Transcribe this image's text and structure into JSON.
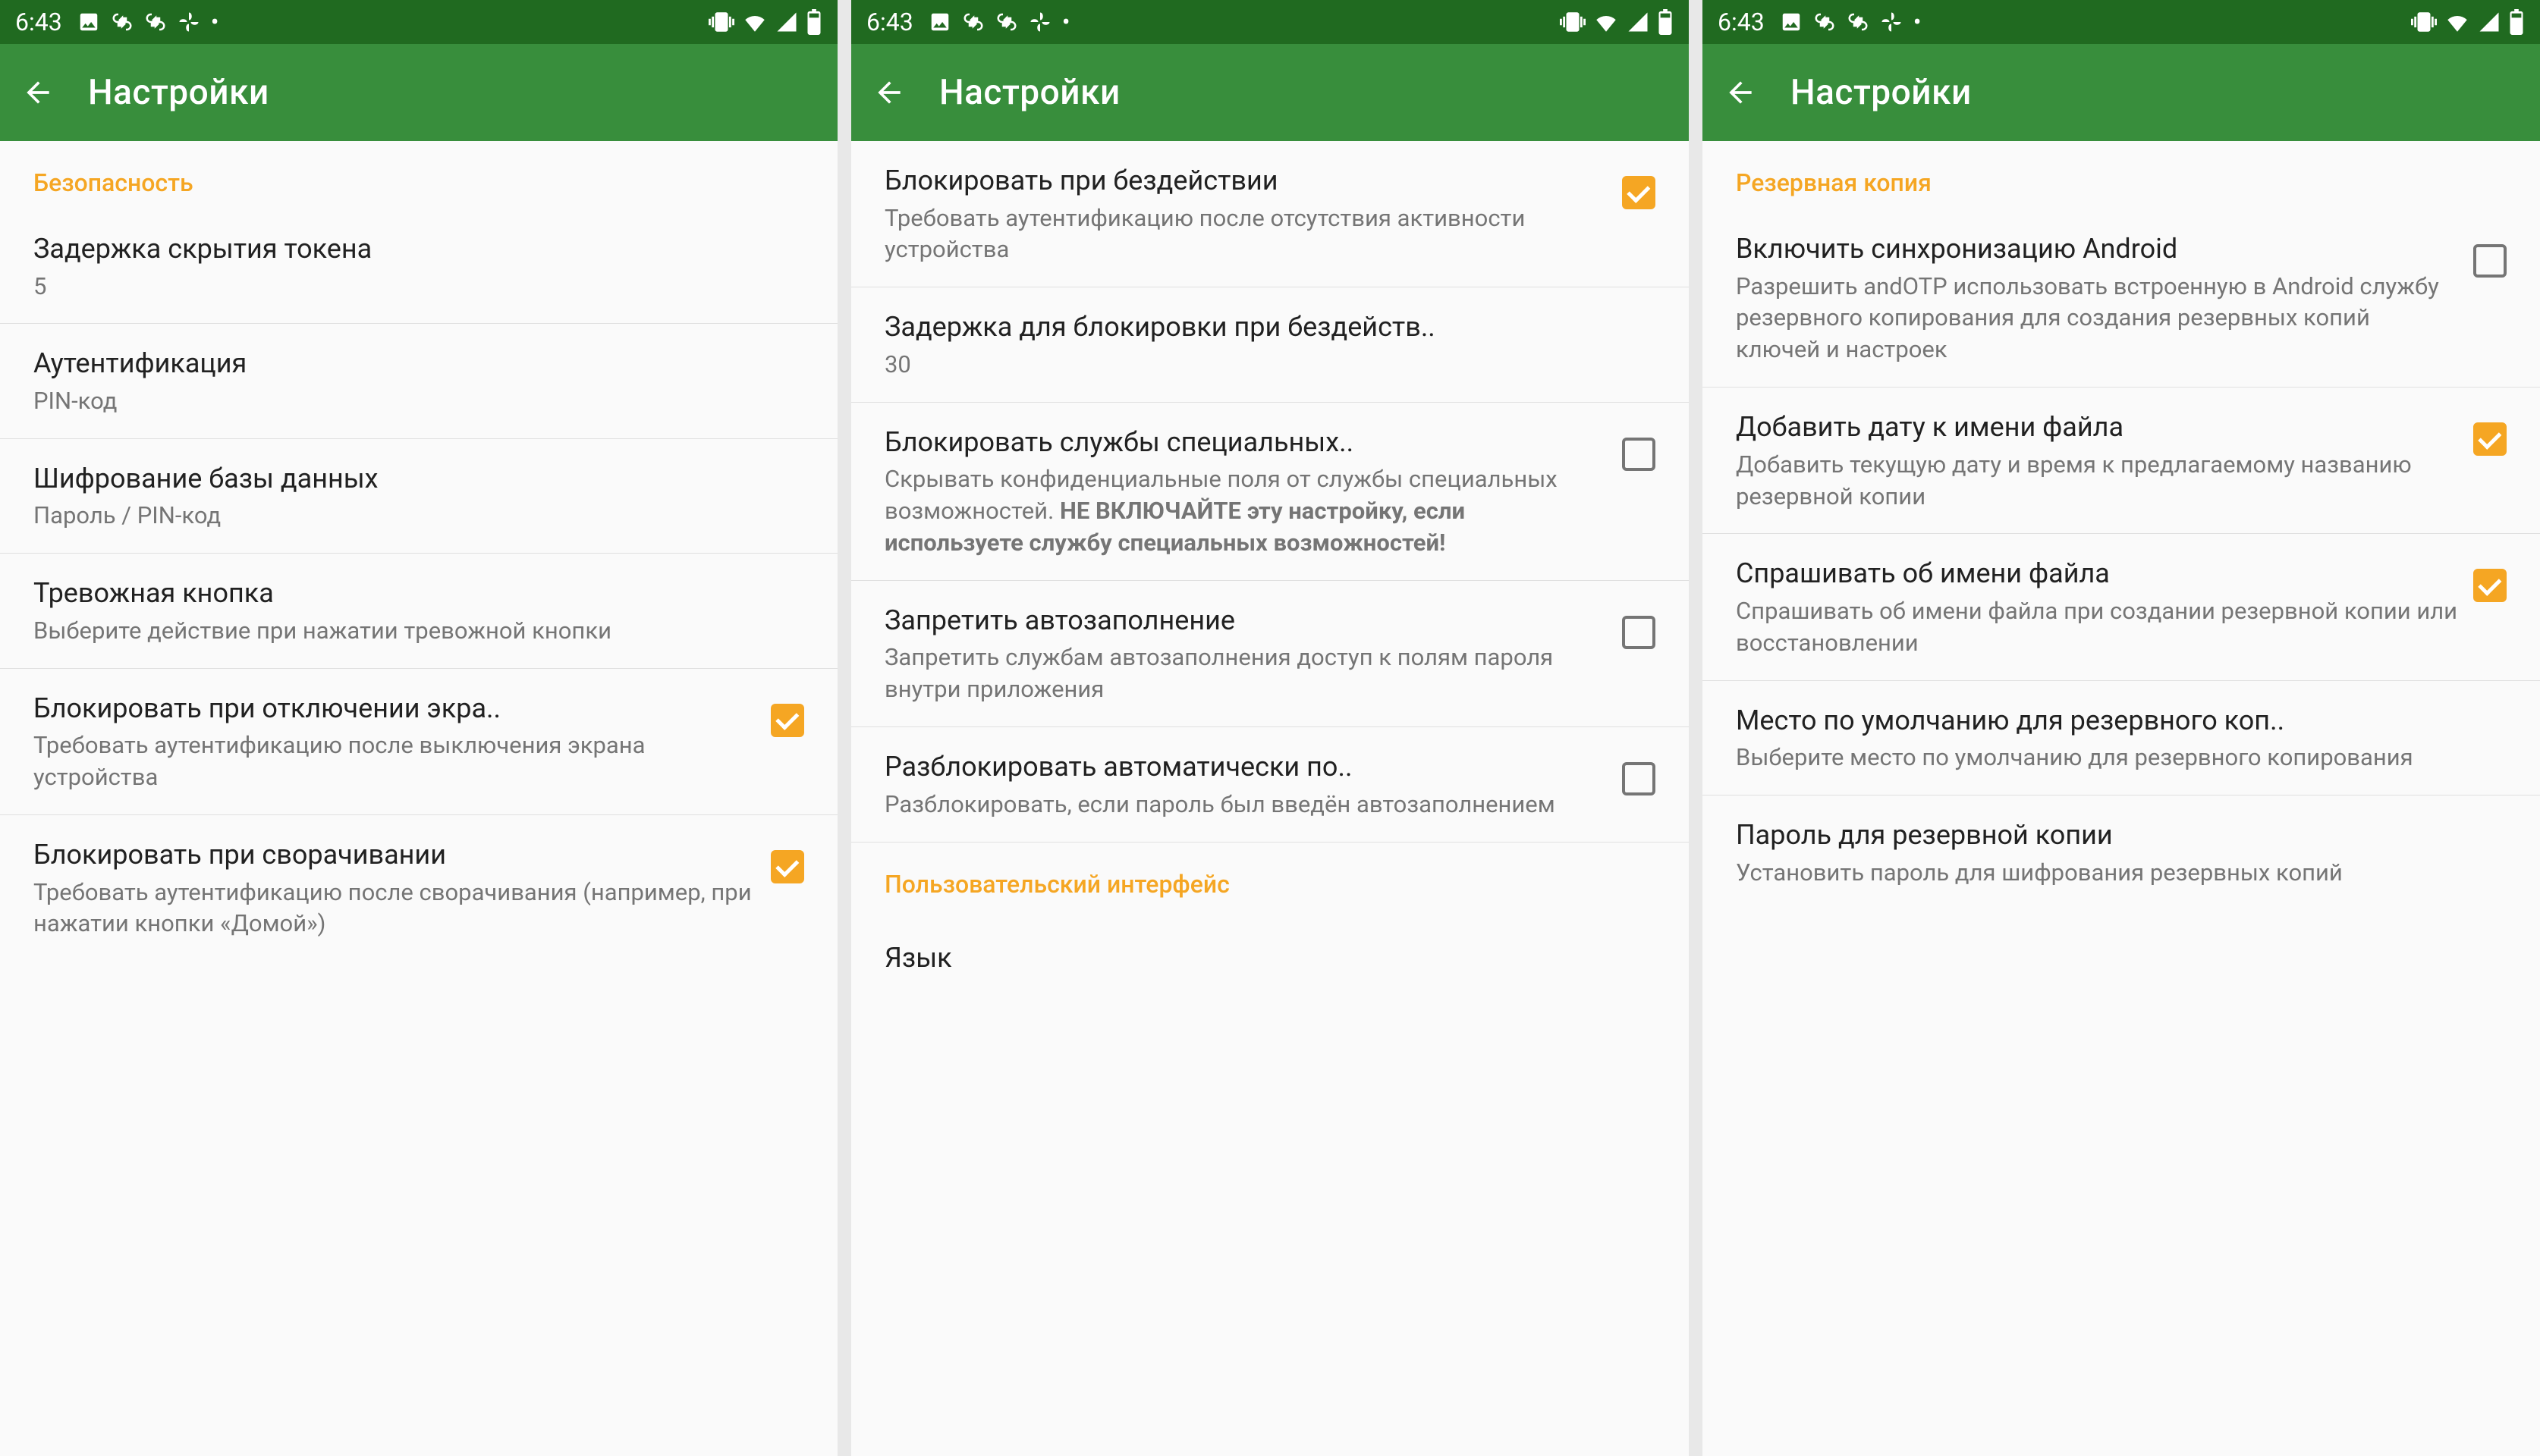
{
  "status": {
    "time": "6:43",
    "icons_left": [
      "image-icon",
      "sync-icon",
      "sync-icon",
      "pinwheel-icon",
      "dot-icon"
    ],
    "icons_right": [
      "vibrate-icon",
      "wifi-icon",
      "signal-icon",
      "battery-icon"
    ]
  },
  "appbar": {
    "title": "Настройки"
  },
  "screens": [
    {
      "section": "Безопасность",
      "rows": [
        {
          "title": "Задержка скрытия токена",
          "sub": "5"
        },
        {
          "title": "Аутентификация",
          "sub": "PIN-код"
        },
        {
          "title": "Шифрование базы данных",
          "sub": "Пароль / PIN-код"
        },
        {
          "title": "Тревожная кнопка",
          "sub": "Выберите действие при нажатии тревожной кнопки"
        },
        {
          "title": "Блокировать при отключении экра..",
          "sub": "Требовать аутентификацию после выключения экрана устройства",
          "check": true
        },
        {
          "title": "Блокировать при сворачивании",
          "sub": "Требовать аутентификацию после сворачивания (например, при нажатии кнопки «Домой»)",
          "check": true
        }
      ]
    },
    {
      "rows": [
        {
          "title": "Блокировать при бездействии",
          "sub": "Требовать аутентификацию после отсутствия активности устройства",
          "check": true
        },
        {
          "title": "Задержка для блокировки при бездейств..",
          "sub": "30"
        },
        {
          "title": "Блокировать службы специальных..",
          "sub": "Скрывать конфиденциальные поля от службы специальных возможностей.",
          "sub_bold": "НЕ ВКЛЮЧАЙТЕ эту настройку, если используете службу специальных возможностей!",
          "check": false
        },
        {
          "title": "Запретить автозаполнение",
          "sub": "Запретить службам автозаполнения доступ к полям пароля внутри приложения",
          "check": false
        },
        {
          "title": "Разблокировать автоматически по..",
          "sub": "Разблокировать, если пароль был введён автозаполнением",
          "check": false
        }
      ],
      "section_bottom": "Пользовательский интерфейс",
      "partial": "Язык"
    },
    {
      "section": "Резервная копия",
      "rows": [
        {
          "title": "Включить синхронизацию Android",
          "sub": "Разрешить andOTP использовать встроенную в Android службу резервного копирования для создания резервных копий ключей и настроек",
          "check": false
        },
        {
          "title": "Добавить дату к имени файла",
          "sub": "Добавить текущую дату и время к предлагаемому названию резервной копии",
          "check": true
        },
        {
          "title": "Спрашивать об имени файла",
          "sub": "Спрашивать об имени файла при создании резервной копии или восстановлении",
          "check": true
        },
        {
          "title": "Место по умолчанию для резервного коп..",
          "sub": "Выберите место по умолчанию для резервного копирования"
        },
        {
          "title": "Пароль для резервной копии",
          "sub": "Установить пароль для шифрования резервных копий"
        }
      ]
    }
  ]
}
